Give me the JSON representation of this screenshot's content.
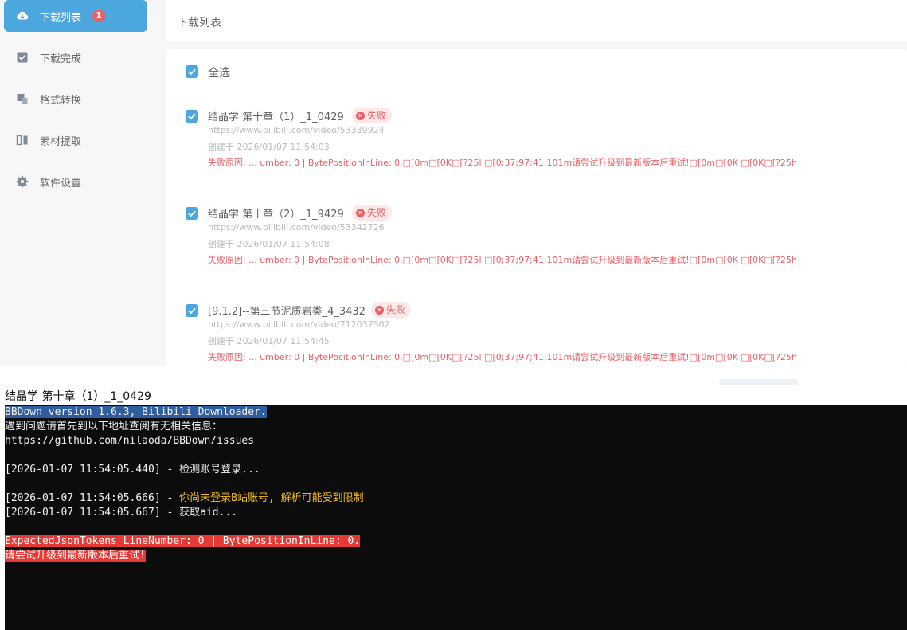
{
  "sidebar": {
    "items": [
      {
        "label": "下载列表",
        "icon": "cloud-download-icon",
        "badge": "1",
        "active": true
      },
      {
        "label": "下载完成",
        "icon": "check-box-icon"
      },
      {
        "label": "格式转换",
        "icon": "convert-icon"
      },
      {
        "label": "素材提取",
        "icon": "extract-icon"
      },
      {
        "label": "软件设置",
        "icon": "gear-icon"
      }
    ]
  },
  "header": {
    "title": "下载列表"
  },
  "list": {
    "select_all_label": "全选",
    "items": [
      {
        "title": "结晶学 第十章（1）_1_0429",
        "status": "失败",
        "url": "https://www.bilibili.com/video/53339924",
        "created": "创建于 2026/01/07 11:54:03",
        "reason": "失败原因: ... umber: 0 | BytePositionInLine: 0.□[0m□[0K□[?25l □[0;37;97;41;101m请尝试升级到最新版本后重试!□[0m□[0K □[0K□[?25h"
      },
      {
        "title": "结晶学 第十章（2）_1_9429",
        "status": "失败",
        "url": "https://www.bilibili.com/video/53342726",
        "created": "创建于 2026/01/07 11:54:08",
        "reason": "失败原因: ... umber: 0 | BytePositionInLine: 0.□[0m□[0K□[?25l □[0;37;97;41;101m请尝试升级到最新版本后重试!□[0m□[0K □[0K□[?25h"
      },
      {
        "title": "[9.1.2]--第三节泥质岩类_4_3432",
        "status": "失败",
        "url": "https://www.bilibili.com/video/712037502",
        "created": "创建于 2026/01/07 11:54:45",
        "reason": "失败原因: ... umber: 0 | BytePositionInLine: 0.□[0m□[0K□[?25l □[0;37;97;41;101m请尝试升级到最新版本后重试!□[0m□[0K □[0K□[?25h"
      }
    ]
  },
  "console": {
    "window_title": "结晶学 第十章（1）_1_0429",
    "lines": {
      "l1": "BBDown version 1.6.3, Bilibili Downloader.",
      "l2": "遇到问题请首先到以下地址查阅有无相关信息：",
      "l3": "https://github.com/nilaoda/BBDown/issues",
      "l4": "[2026-01-07 11:54:05.440] - 检测账号登录...",
      "l5_time": "[2026-01-07 11:54:05.666] - ",
      "l5_msg": "你尚未登录B站账号, 解析可能受到限制",
      "l6": "[2026-01-07 11:54:05.667] - 获取aid...",
      "l7": "ExpectedJsonTokens LineNumber: 0 | BytePositionInLine: 0.",
      "l8": "请尝试升级到最新版本后重试!"
    }
  },
  "colors": {
    "accent": "#1a8fd6",
    "error": "#e8323c",
    "warning_text": "#f5bd20",
    "terminal_bg": "#0c0c0c"
  }
}
